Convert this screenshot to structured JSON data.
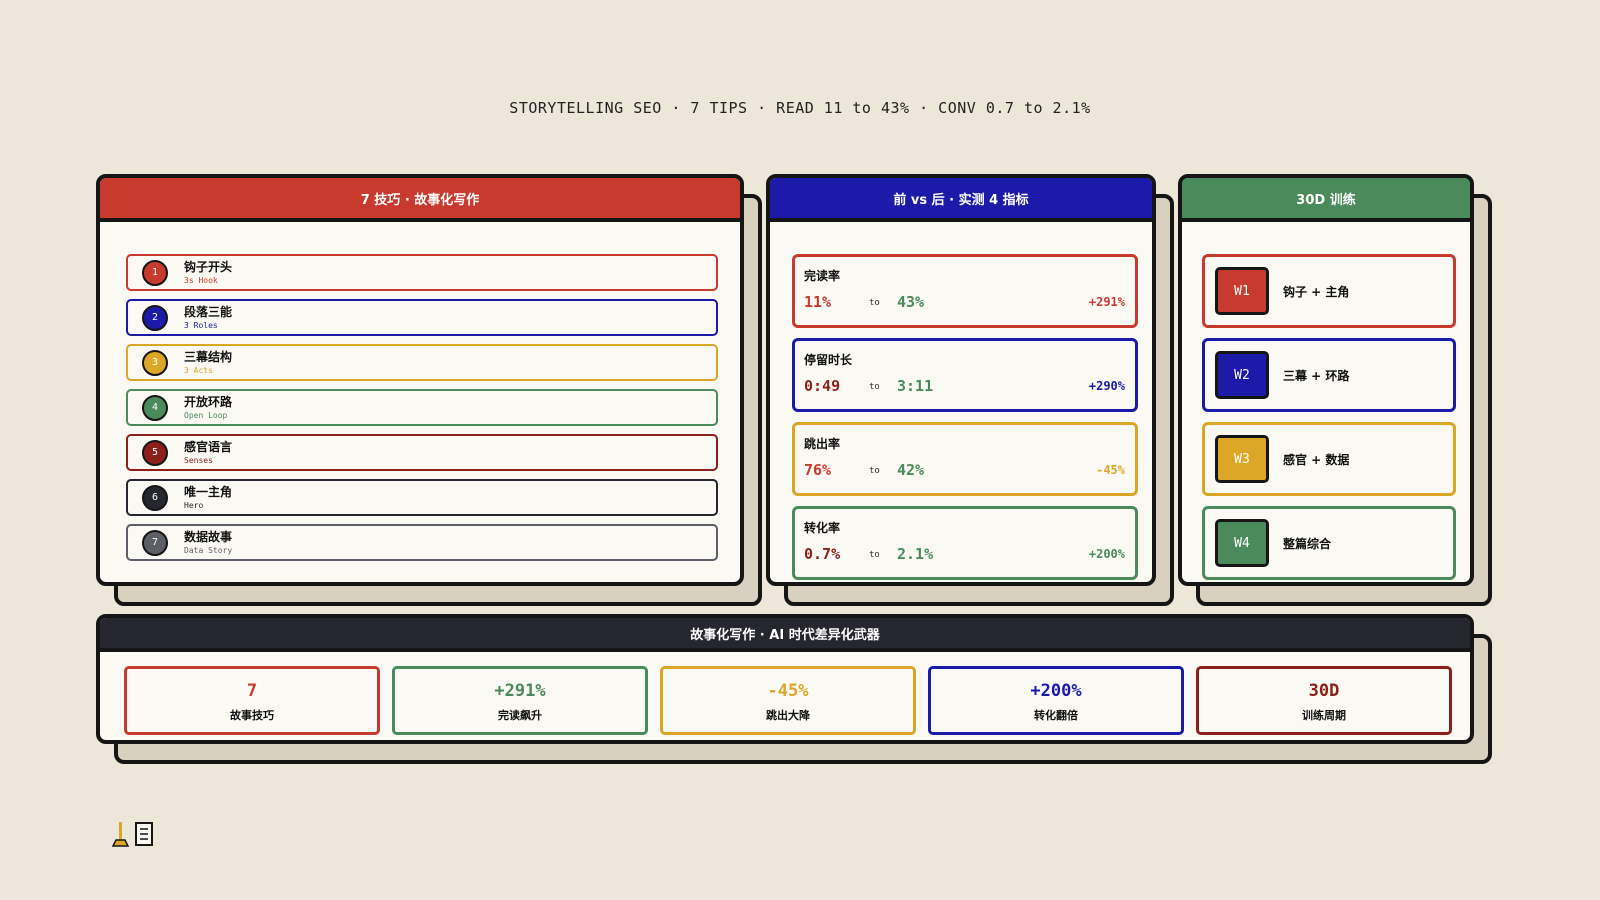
{
  "headline": "STORYTELLING SEO · 7 TIPS · READ 11 to 43% · CONV 0.7 to 2.1%",
  "colors": {
    "red": "#c93a2e",
    "navy": "#1c1aa8",
    "gold": "#dca726",
    "green": "#4b8a5a",
    "maroon": "#8c1f1a",
    "dark": "#26262e",
    "grey": "#5e5e66",
    "bg": "#ece7d9"
  },
  "tips_panel": {
    "title": "7 技巧 · 故事化写作",
    "items": [
      {
        "num": "1",
        "zh": "钩子开头",
        "en": "3s Hook"
      },
      {
        "num": "2",
        "zh": "段落三能",
        "en": "3 Roles"
      },
      {
        "num": "3",
        "zh": "三幕结构",
        "en": "3 Acts"
      },
      {
        "num": "4",
        "zh": "开放环路",
        "en": "Open Loop"
      },
      {
        "num": "5",
        "zh": "感官语言",
        "en": "Senses"
      },
      {
        "num": "6",
        "zh": "唯一主角",
        "en": "Hero"
      },
      {
        "num": "7",
        "zh": "数据故事",
        "en": "Data Story"
      }
    ]
  },
  "metrics_panel": {
    "title": "前 vs 后 · 实测 4 指标",
    "items": [
      {
        "label": "完读率",
        "before": "11%",
        "to": "to",
        "after": "43%",
        "delta": "+291%"
      },
      {
        "label": "停留时长",
        "before": "0:49",
        "to": "to",
        "after": "3:11",
        "delta": "+290%"
      },
      {
        "label": "跳出率",
        "before": "76%",
        "to": "to",
        "after": "42%",
        "delta": "-45%"
      },
      {
        "label": "转化率",
        "before": "0.7%",
        "to": "to",
        "after": "2.1%",
        "delta": "+200%"
      }
    ]
  },
  "training_panel": {
    "title": "30D 训练",
    "items": [
      {
        "badge": "W1",
        "text": "钩子 + 主角"
      },
      {
        "badge": "W2",
        "text": "三幕 + 环路"
      },
      {
        "badge": "W3",
        "text": "感官 + 数据"
      },
      {
        "badge": "W4",
        "text": "整篇综合"
      }
    ]
  },
  "summary_panel": {
    "title": "故事化写作 · AI 时代差异化武器",
    "items": [
      {
        "value": "7",
        "label": "故事技巧"
      },
      {
        "value": "+291%",
        "label": "完读飙升"
      },
      {
        "value": "-45%",
        "label": "跳出大降"
      },
      {
        "value": "+200%",
        "label": "转化翻倍"
      },
      {
        "value": "30D",
        "label": "训练周期"
      }
    ]
  },
  "logo_icon": "writing-brush-document-icon"
}
